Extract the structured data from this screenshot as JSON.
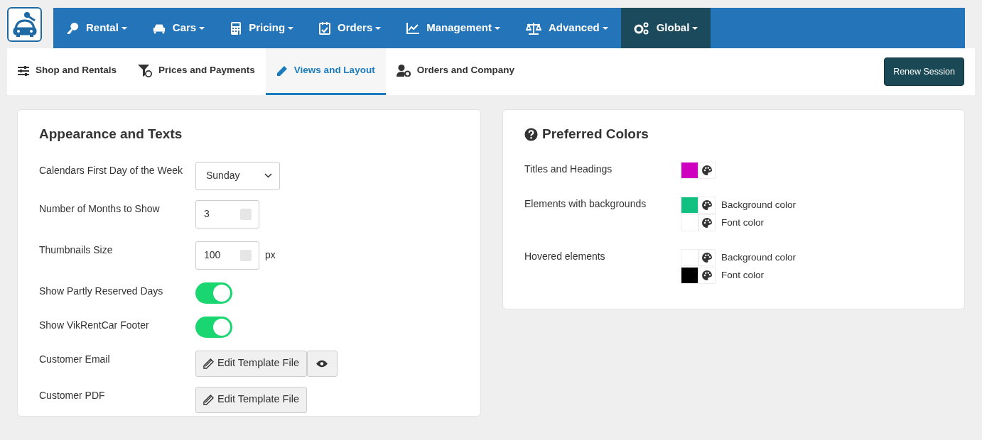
{
  "menu": [
    {
      "label": "Rental",
      "selected": false
    },
    {
      "label": "Cars",
      "selected": false
    },
    {
      "label": "Pricing",
      "selected": false
    },
    {
      "label": "Orders",
      "selected": false
    },
    {
      "label": "Management",
      "selected": false
    },
    {
      "label": "Advanced",
      "selected": false
    },
    {
      "label": "Global",
      "selected": true
    }
  ],
  "tabs": [
    {
      "label": "Shop and Rentals",
      "selected": false
    },
    {
      "label": "Prices and Payments",
      "selected": false
    },
    {
      "label": "Views and Layout",
      "selected": true
    },
    {
      "label": "Orders and Company",
      "selected": false
    }
  ],
  "renew_button": "Renew Session",
  "appearance": {
    "title": "Appearance and Texts",
    "rows": [
      {
        "kind": "select",
        "label": "Calendars First Day of the Week",
        "value": "Sunday"
      },
      {
        "kind": "number",
        "label": "Number of Months to Show",
        "value": "3"
      },
      {
        "kind": "number",
        "label": "Thumbnails Size",
        "value": "100",
        "unit": "px"
      },
      {
        "kind": "toggle",
        "label": "Show Partly Reserved Days",
        "on": true
      },
      {
        "kind": "toggle",
        "label": "Show VikRentCar Footer",
        "on": true
      },
      {
        "kind": "template",
        "label": "Customer Email",
        "button": "Edit Template File",
        "preview": true
      },
      {
        "kind": "template",
        "label": "Customer PDF",
        "button": "Edit Template File",
        "preview": false
      }
    ]
  },
  "colors": {
    "title": "Preferred Colors",
    "groups": [
      {
        "label": "Titles and Headings",
        "swatches": [
          {
            "color": "#d000c0"
          }
        ]
      },
      {
        "label": "Elements with backgrounds",
        "swatches": [
          {
            "color": "#10c080",
            "label": "Background color"
          },
          {
            "color": "#ffffff",
            "label": "Font color"
          }
        ]
      },
      {
        "label": "Hovered elements",
        "swatches": [
          {
            "color": "#ffffff",
            "label": "Background color"
          },
          {
            "color": "#000000",
            "label": "Font color"
          }
        ]
      }
    ]
  }
}
